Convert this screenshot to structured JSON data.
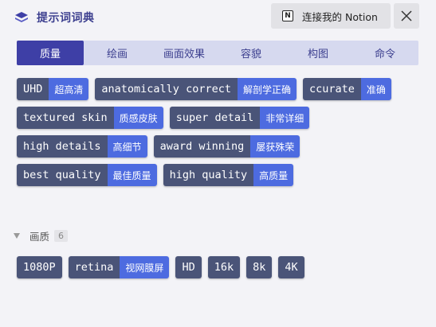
{
  "header": {
    "title": "提示词词典",
    "logo_icon": "book-stack-icon",
    "notion_label": "连接我的 Notion",
    "notion_icon_glyph": "N",
    "close_icon": "close-icon"
  },
  "tabs": [
    {
      "label": "质量",
      "active": true
    },
    {
      "label": "绘画",
      "active": false
    },
    {
      "label": "画面效果",
      "active": false
    },
    {
      "label": "容貌",
      "active": false
    },
    {
      "label": "构图",
      "active": false
    },
    {
      "label": "命令",
      "active": false
    }
  ],
  "quality_tags": [
    {
      "en": "UHD",
      "zh": "超高清"
    },
    {
      "en": "anatomically correct",
      "zh": "解剖学正确"
    },
    {
      "en": "ccurate",
      "zh": "准确"
    },
    {
      "en": "textured skin",
      "zh": "质感皮肤"
    },
    {
      "en": "super detail",
      "zh": "非常详细"
    },
    {
      "en": "high details",
      "zh": "高细节"
    },
    {
      "en": "award winning",
      "zh": "屡获殊荣"
    },
    {
      "en": "best quality",
      "zh": "最佳质量"
    },
    {
      "en": "high quality",
      "zh": "高质量"
    }
  ],
  "section": {
    "title": "画质",
    "count": "6"
  },
  "image_quality_tags": [
    {
      "en": "1080P",
      "zh": ""
    },
    {
      "en": "retina",
      "zh": "视网膜屏"
    },
    {
      "en": "HD",
      "zh": ""
    },
    {
      "en": "16k",
      "zh": ""
    },
    {
      "en": "8k",
      "zh": ""
    },
    {
      "en": "4K",
      "zh": ""
    }
  ],
  "colors": {
    "accent": "#3e3fa6",
    "tag_en_bg": "#4a5478",
    "tag_zh_bg": "#4d6be0",
    "tab_bar_bg": "#d6d9ef"
  }
}
